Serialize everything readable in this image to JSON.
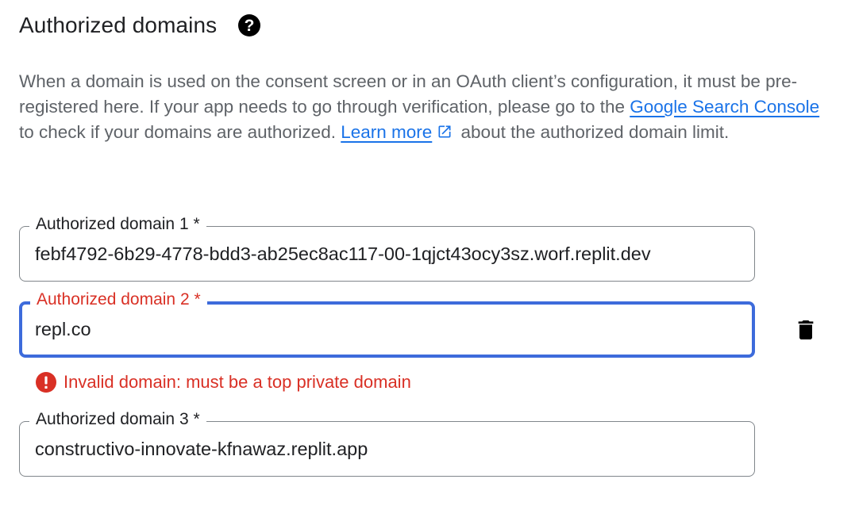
{
  "section": {
    "title": "Authorized domains",
    "help_icon": "help-circle-icon"
  },
  "description": {
    "text_1": "When a domain is used on the consent screen or in an OAuth client’s configuration, it must be pre-registered here. If your app needs to go through verification, please go to the ",
    "link_search_console": "Google Search Console ",
    "text_2": "to check if your domains are authorized. ",
    "link_learn_more": "Learn more",
    "external_icon": "open-in-new-icon",
    "text_3": " about the authorized domain limit."
  },
  "domains": [
    {
      "label": "Authorized domain 1 *",
      "value": "febf4792-6b29-4778-bdd3-ab25ec8ac117-00-1qjct43ocy3sz.worf.replit.dev"
    },
    {
      "label": "Authorized domain 2 *",
      "value": "repl.co",
      "error": "Invalid domain: must be a top private domain",
      "delete_icon": "trash-icon"
    },
    {
      "label": "Authorized domain 3 *",
      "value": "constructivo-innovate-kfnawaz.replit.app"
    }
  ],
  "colors": {
    "link": "#1a73e8",
    "error": "#d93025",
    "focus_border": "#3d6bdb",
    "text": "#202124",
    "secondary_text": "#5f6368"
  }
}
